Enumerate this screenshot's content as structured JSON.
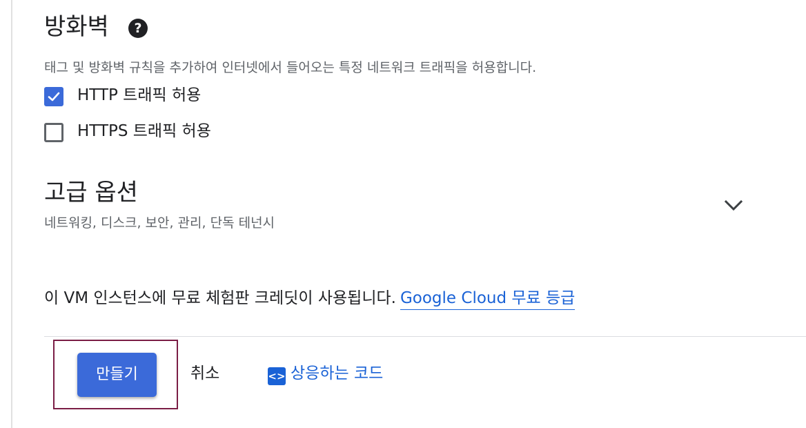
{
  "firewall": {
    "title": "방화벽",
    "help_glyph": "?",
    "description": "태그 및 방화벽 규칙을 추가하여 인터넷에서 들어오는 특정 네트워크 트래픽을 허용합니다.",
    "options": [
      {
        "label": "HTTP 트래픽 허용",
        "checked": true
      },
      {
        "label": "HTTPS 트래픽 허용",
        "checked": false
      }
    ]
  },
  "advanced": {
    "title": "고급 옵션",
    "subtitle": "네트워킹, 디스크, 보안, 관리, 단독 테넌시",
    "expanded": false
  },
  "notice": {
    "text": "이 VM 인스턴스에 무료 체험판 크레딧이 사용됩니다.",
    "link_label": "Google Cloud 무료 등급"
  },
  "actions": {
    "create_label": "만들기",
    "cancel_label": "취소",
    "equivalent_code_label": "상응하는 코드",
    "code_glyph": "<>"
  },
  "colors": {
    "accent": "#3b6ad9",
    "link": "#1a62d6",
    "focus_outline": "#7a1d45"
  },
  "icons": {
    "help": "help-circle-icon",
    "checkbox_checked": "checkmark-icon",
    "expand": "chevron-down-icon",
    "code": "code-brackets-icon"
  }
}
